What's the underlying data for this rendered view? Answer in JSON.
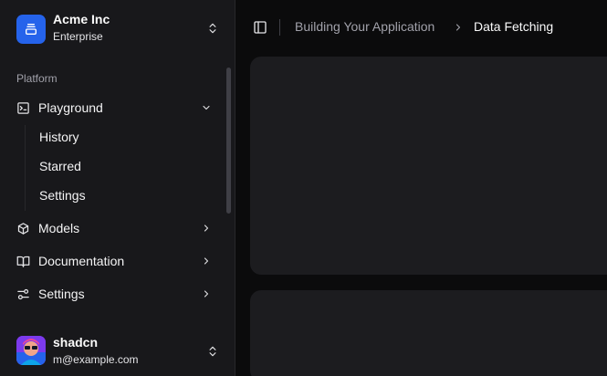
{
  "team": {
    "name": "Acme Inc",
    "plan": "Enterprise",
    "logo_icon": "stack-icon",
    "accent": "#2563eb"
  },
  "sidebar": {
    "group_label": "Platform",
    "items": [
      {
        "label": "Playground",
        "icon": "terminal-icon",
        "expanded": true,
        "sub_items": [
          {
            "label": "History"
          },
          {
            "label": "Starred"
          },
          {
            "label": "Settings"
          }
        ]
      },
      {
        "label": "Models",
        "icon": "bot-icon",
        "expanded": false
      },
      {
        "label": "Documentation",
        "icon": "book-icon",
        "expanded": false
      },
      {
        "label": "Settings",
        "icon": "settings-icon",
        "expanded": false
      }
    ]
  },
  "user": {
    "name": "shadcn",
    "email": "m@example.com"
  },
  "breadcrumb": {
    "parent": "Building Your Application",
    "current": "Data Fetching"
  }
}
